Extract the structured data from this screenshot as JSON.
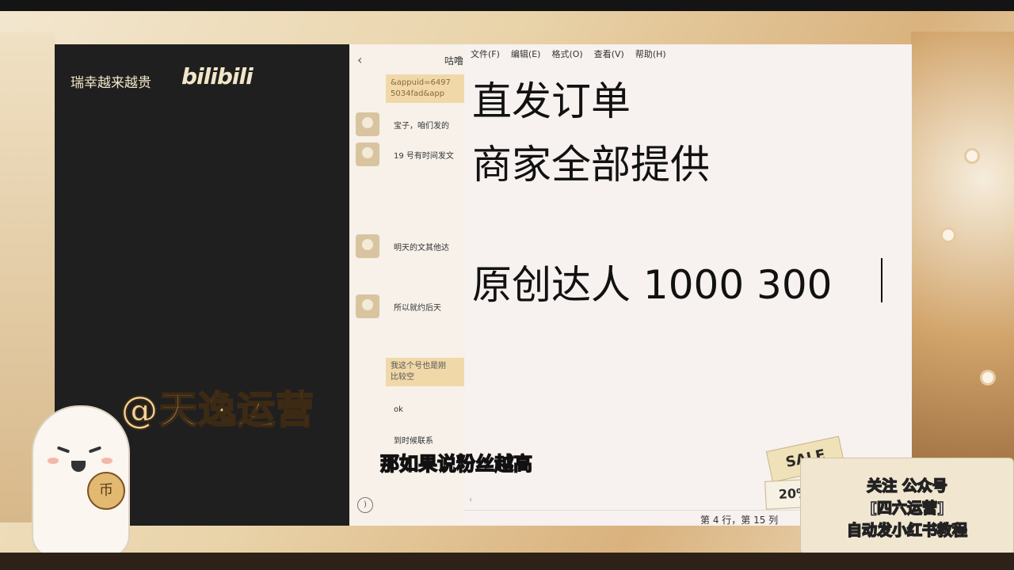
{
  "video": {
    "caption": "瑞幸越来越贵",
    "logo": "bilibili"
  },
  "chat": {
    "title": "咕噜",
    "link_text_1": "&appuid=6497",
    "link_text_2": "5034fad&app",
    "messages": [
      "宝子，咱们发的",
      "19 号有时间发文",
      "明天的文其他达",
      "所以就约后天",
      "我这个号也是刚",
      "比较空",
      "ok",
      "到时候联系"
    ]
  },
  "notepad": {
    "menu": [
      "文件(F)",
      "编辑(E)",
      "格式(O)",
      "查看(V)",
      "帮助(H)"
    ],
    "lines": [
      "直发订单",
      "商家全部提供",
      "",
      "原创达人  1000 300"
    ],
    "status": "第 4 行，第 15 列"
  },
  "overlay": {
    "watermark": "@天逸运营",
    "subtitle": "那如果说粉丝越高",
    "coin_glyph": "币",
    "sale_label": "SALE",
    "discount_label": "20%",
    "promo_lines": [
      "关注 公众号",
      "[四六运营]",
      "自动发小红书教程"
    ]
  },
  "colors": {
    "video_bg": "#1f1f1f",
    "notepad_bg": "#f7f1ef",
    "bubble": "#f0d8a8",
    "watermark_fill": "#f1d39d"
  }
}
